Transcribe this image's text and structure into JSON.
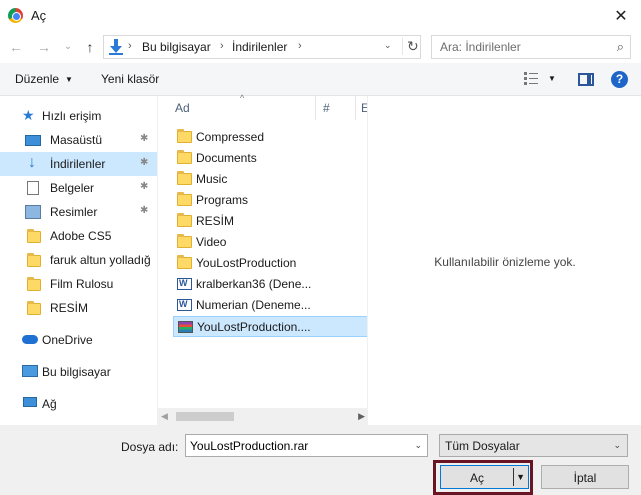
{
  "window": {
    "title": "Aç",
    "close_glyph": "✕"
  },
  "nav": {
    "back_glyph": "←",
    "forward_glyph": "→",
    "recent_glyph": "⌄",
    "up_glyph": "↑",
    "address": {
      "parts": [
        "Bu bilgisayar",
        "İndirilenler"
      ],
      "separator": "›",
      "dropdown_glyph": "⌄",
      "refresh_glyph": "↻"
    },
    "search": {
      "placeholder": "Ara: İndirilenler",
      "value": "",
      "icon_glyph": "⌕"
    }
  },
  "toolbar": {
    "organize_label": "Düzenle",
    "organize_caret": "▼",
    "new_folder_label": "Yeni klasör",
    "view_caret": "▼",
    "help_label": "?"
  },
  "sidebar": {
    "pin_glyph": "✱",
    "items": [
      {
        "label": "Hızlı erişim",
        "icon": "star-icon"
      },
      {
        "label": "Masaüstü",
        "icon": "desktop-icon",
        "pinned": true
      },
      {
        "label": "İndirilenler",
        "icon": "downloads-icon",
        "pinned": true,
        "selected": true
      },
      {
        "label": "Belgeler",
        "icon": "documents-icon",
        "pinned": true
      },
      {
        "label": "Resimler",
        "icon": "pictures-icon",
        "pinned": true
      },
      {
        "label": "Adobe CS5",
        "icon": "folder-icon"
      },
      {
        "label": "faruk altun yolladığ",
        "icon": "folder-icon"
      },
      {
        "label": "Film Rulosu",
        "icon": "folder-icon"
      },
      {
        "label": "RESİM",
        "icon": "folder-icon"
      },
      {
        "label": "OneDrive",
        "icon": "onedrive-icon"
      },
      {
        "label": "Bu bilgisayar",
        "icon": "computer-icon"
      },
      {
        "label": "Ağ",
        "icon": "network-icon"
      }
    ]
  },
  "filelist": {
    "columns": [
      "Ad",
      "#",
      "E"
    ],
    "sort_glyph": "^",
    "items": [
      {
        "name": "Compressed",
        "type": "folder"
      },
      {
        "name": "Documents",
        "type": "folder"
      },
      {
        "name": "Music",
        "type": "folder"
      },
      {
        "name": "Programs",
        "type": "folder"
      },
      {
        "name": "RESİM",
        "type": "folder"
      },
      {
        "name": "Video",
        "type": "folder"
      },
      {
        "name": "YouLostProduction",
        "type": "folder"
      },
      {
        "name": "kralberkan36 (Dene...",
        "type": "word"
      },
      {
        "name": "Numerian (Deneme...",
        "type": "word"
      },
      {
        "name": "YouLostProduction....",
        "type": "rar",
        "selected": true
      }
    ],
    "scroll_left_glyph": "◀",
    "scroll_right_glyph": "▶"
  },
  "preview": {
    "empty_text": "Kullanılabilir önizleme yok."
  },
  "footer": {
    "filename_label": "Dosya adı:",
    "filename_value": "YouLostProduction.rar",
    "dropdown_glyph": "⌄",
    "filetype_value": "Tüm Dosyalar",
    "open_label": "Aç",
    "open_caret": "▼",
    "cancel_label": "İptal"
  },
  "colors": {
    "selection": "#cce8ff",
    "accent": "#0078d7",
    "highlight_frame": "#6a1524"
  }
}
